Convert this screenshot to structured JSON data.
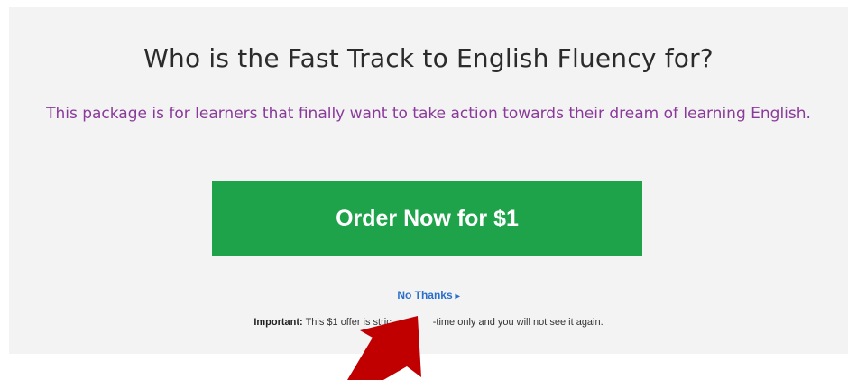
{
  "offer": {
    "headline": "Who is the Fast Track to English Fluency for?",
    "subtext": "This package is for learners that finally want to take action towards their dream of learning English.",
    "cta_label": "Order Now for $1",
    "decline_label": "No Thanks",
    "decline_arrow": "▸",
    "important_label": "Important:",
    "important_text_before": "This $1 offer is stric",
    "important_text_after": "-time only and you will not see it again."
  },
  "colors": {
    "cta_background": "#1ea34a",
    "subtext": "#8a3a9a",
    "link": "#2a6fc9",
    "annotation_arrow": "#c00000"
  },
  "icons": {
    "annotation": "red-arrow-icon"
  }
}
